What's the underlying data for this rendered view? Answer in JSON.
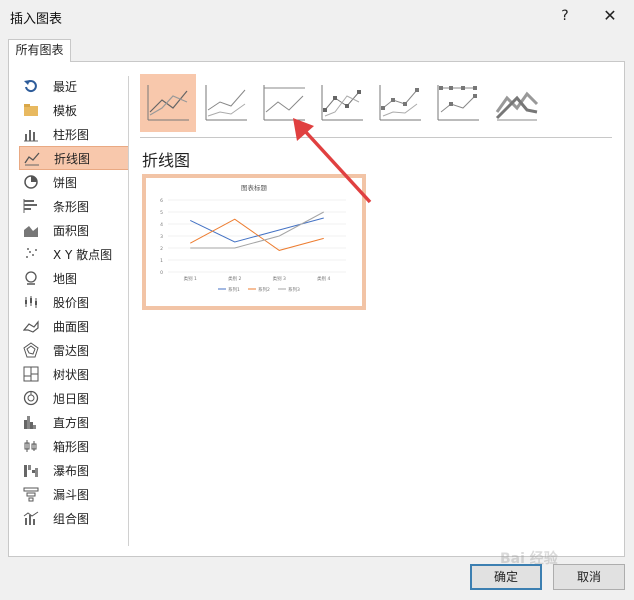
{
  "window": {
    "title": "插入图表",
    "help": "?",
    "close": "✕"
  },
  "tab": {
    "label": "所有图表"
  },
  "sidebar": {
    "items": [
      {
        "label": "最近",
        "icon": "recent-icon"
      },
      {
        "label": "模板",
        "icon": "folder-icon"
      },
      {
        "label": "柱形图",
        "icon": "column-chart-icon"
      },
      {
        "label": "折线图",
        "icon": "line-chart-icon",
        "active": true
      },
      {
        "label": "饼图",
        "icon": "pie-chart-icon"
      },
      {
        "label": "条形图",
        "icon": "bar-chart-icon"
      },
      {
        "label": "面积图",
        "icon": "area-chart-icon"
      },
      {
        "label": "X Y 散点图",
        "icon": "scatter-chart-icon"
      },
      {
        "label": "地图",
        "icon": "map-chart-icon"
      },
      {
        "label": "股价图",
        "icon": "stock-chart-icon"
      },
      {
        "label": "曲面图",
        "icon": "surface-chart-icon"
      },
      {
        "label": "雷达图",
        "icon": "radar-chart-icon"
      },
      {
        "label": "树状图",
        "icon": "treemap-chart-icon"
      },
      {
        "label": "旭日图",
        "icon": "sunburst-chart-icon"
      },
      {
        "label": "直方图",
        "icon": "histogram-chart-icon"
      },
      {
        "label": "箱形图",
        "icon": "box-chart-icon"
      },
      {
        "label": "瀑布图",
        "icon": "waterfall-chart-icon"
      },
      {
        "label": "漏斗图",
        "icon": "funnel-chart-icon"
      },
      {
        "label": "组合图",
        "icon": "combo-chart-icon"
      }
    ]
  },
  "section": {
    "title": "折线图"
  },
  "preview": {
    "title": "图表标题",
    "yticks": [
      "0",
      "1",
      "2",
      "3",
      "4",
      "5",
      "6"
    ],
    "categories": [
      "类别 1",
      "类别 2",
      "类别 3",
      "类别 4"
    ],
    "legend": [
      "系列1",
      "系列2",
      "系列3"
    ],
    "colors": [
      "#4472c4",
      "#ed7d31",
      "#a5a5a5"
    ]
  },
  "chart_data": {
    "type": "line",
    "title": "图表标题",
    "categories": [
      "类别 1",
      "类别 2",
      "类别 3",
      "类别 4"
    ],
    "series": [
      {
        "name": "系列1",
        "values": [
          4.3,
          2.5,
          3.5,
          4.5
        ]
      },
      {
        "name": "系列2",
        "values": [
          2.4,
          4.4,
          1.8,
          2.8
        ]
      },
      {
        "name": "系列3",
        "values": [
          2,
          2,
          3,
          5
        ]
      }
    ],
    "ylim": [
      0,
      6
    ],
    "legend": "bottom"
  },
  "buttons": {
    "ok": "确定",
    "cancel": "取消"
  },
  "watermark": "Bai 经验"
}
